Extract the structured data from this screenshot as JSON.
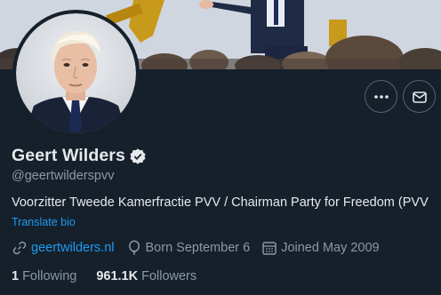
{
  "profile": {
    "name": "Geert Wilders",
    "handle": "@geertwilderspvv",
    "bio": "Voorzitter Tweede Kamerfractie PVV / Chairman Party for Freedom (PVV",
    "translate_label": "Translate bio",
    "website": "geertwilders.nl",
    "born": "Born September 6",
    "joined": "Joined May 2009"
  },
  "stats": {
    "following_count": "1",
    "following_label": "Following",
    "followers_count": "961.1K",
    "followers_label": "Followers"
  },
  "icons": {
    "more": "more-icon",
    "message": "mail-icon",
    "verified": "verified-badge-icon",
    "link": "link-icon",
    "birthday": "balloon-icon",
    "joined": "calendar-icon"
  },
  "colors": {
    "background": "#15202b",
    "accent": "#1d9bf0",
    "muted": "#8b98a5",
    "text": "#e7e9ea"
  }
}
